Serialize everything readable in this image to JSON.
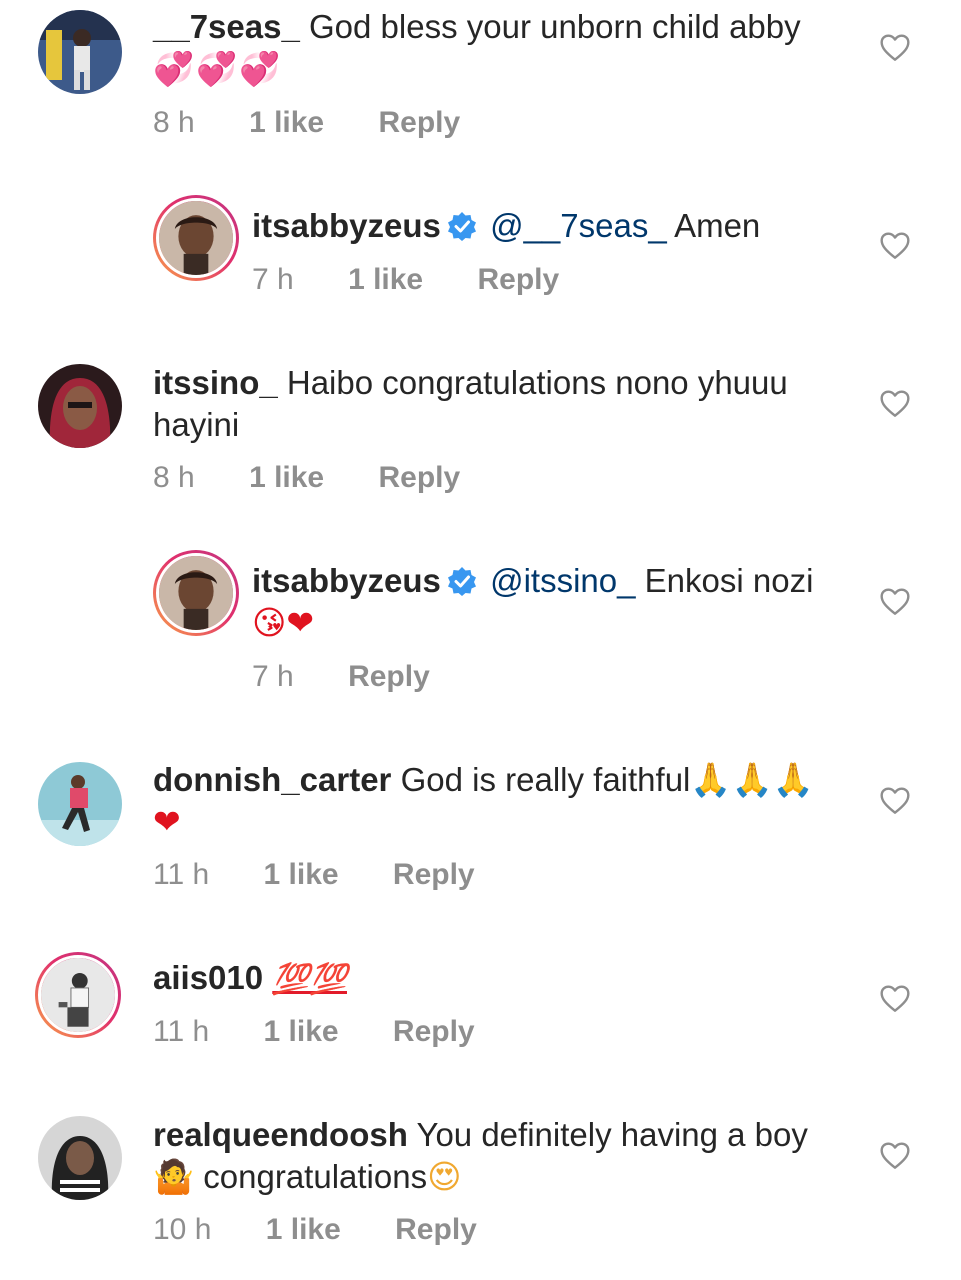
{
  "comments": [
    {
      "username": "__7seas_",
      "text": "God bless your unborn child abby",
      "emoji": "💞💞💞",
      "time": "8 h",
      "likes": "1 like",
      "reply": "Reply"
    },
    {
      "username": "itsabbyzeus",
      "mention": "@__7seas_",
      "text": "Amen",
      "time": "7 h",
      "likes": "1 like",
      "reply": "Reply"
    },
    {
      "username": "itssino_",
      "text": "Haibo congratulations nono yhuuu hayini",
      "time": "8 h",
      "likes": "1 like",
      "reply": "Reply"
    },
    {
      "username": "itsabbyzeus",
      "mention": "@itssino_",
      "text": "Enkosi nozi",
      "emoji": "😘❤",
      "time": "7 h",
      "reply": "Reply"
    },
    {
      "username": "donnish_carter",
      "text": "God is really faithful",
      "emoji": "🙏🙏🙏",
      "emoji2": "❤",
      "time": "11 h",
      "likes": "1 like",
      "reply": "Reply"
    },
    {
      "username": "aiis010",
      "emoji": "💯💯",
      "time": "11 h",
      "likes": "1 like",
      "reply": "Reply"
    },
    {
      "username": "realqueendoosh",
      "text": "You definitely having a boy",
      "emoji": "🤷",
      "text2": "congratulations",
      "emoji2": "😍",
      "time": "10 h",
      "likes": "1 like",
      "reply": "Reply"
    }
  ],
  "colors": {
    "text": "#262626",
    "meta": "#8e8e8e",
    "mention": "#00376b",
    "verified": "#3897f0"
  },
  "icons": {
    "like": "heart-outline-icon",
    "verified": "verified-badge-icon"
  }
}
